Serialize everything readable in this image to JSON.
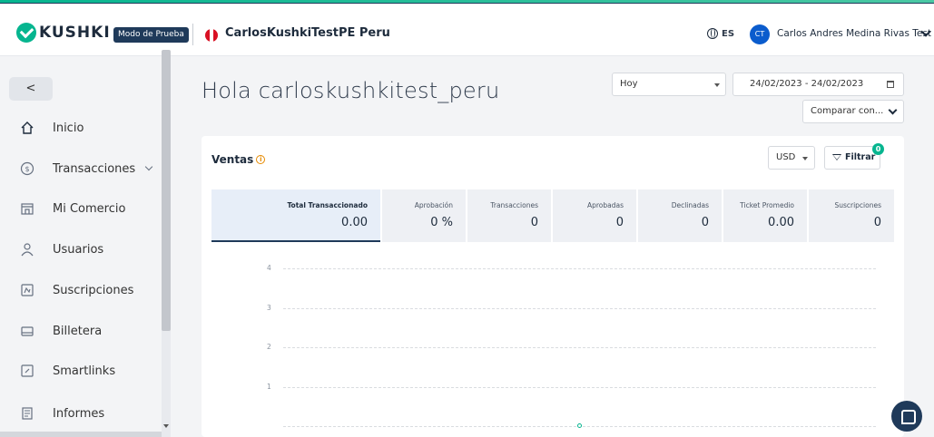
{
  "header": {
    "brand": "KUSHKI",
    "mode_badge": "Modo de Prueba",
    "merchant_name": "CarlosKushkiTestPE Peru",
    "language": "ES",
    "avatar_initials": "CT",
    "user_name": "Carlos Andres Medina Rivas Test"
  },
  "sidebar": {
    "collapse_label": "<",
    "items": [
      {
        "label": "Inicio",
        "icon": "home-icon"
      },
      {
        "label": "Transacciones",
        "icon": "dollar-icon"
      },
      {
        "label": "Mi Comercio",
        "icon": "store-icon"
      },
      {
        "label": "Usuarios",
        "icon": "user-icon"
      },
      {
        "label": "Suscripciones",
        "icon": "subscription-icon"
      },
      {
        "label": "Billetera",
        "icon": "wallet-icon"
      },
      {
        "label": "Smartlinks",
        "icon": "link-icon"
      },
      {
        "label": "Informes",
        "icon": "report-icon"
      }
    ]
  },
  "main": {
    "greeting": "Hola carloskushkitest_peru",
    "period": "Hoy",
    "date_range": "24/02/2023 - 24/02/2023",
    "compare": "Comparar con..."
  },
  "sales_card": {
    "title": "Ventas",
    "currency": "USD",
    "filter_label": "Filtrar",
    "filter_count": "0",
    "metrics": [
      {
        "label": "Total Transaccionado",
        "value": "0.00"
      },
      {
        "label": "Aprobación",
        "value": "0 %"
      },
      {
        "label": "Transacciones",
        "value": "0"
      },
      {
        "label": "Aprobadas",
        "value": "0"
      },
      {
        "label": "Declinadas",
        "value": "0"
      },
      {
        "label": "Ticket Promedio",
        "value": "0.00"
      },
      {
        "label": "Suscripciones",
        "value": "0"
      }
    ]
  },
  "chart_data": {
    "type": "line",
    "title": "",
    "xlabel": "",
    "ylabel": "",
    "y_ticks": [
      "4",
      "3",
      "2",
      "1"
    ],
    "ylim": [
      0,
      4
    ],
    "grid": true,
    "series": [
      {
        "values": [
          0
        ]
      }
    ]
  },
  "colors": {
    "accent": "#06b58f",
    "navy": "#1f3a5a",
    "peru_red": "#d91023"
  }
}
